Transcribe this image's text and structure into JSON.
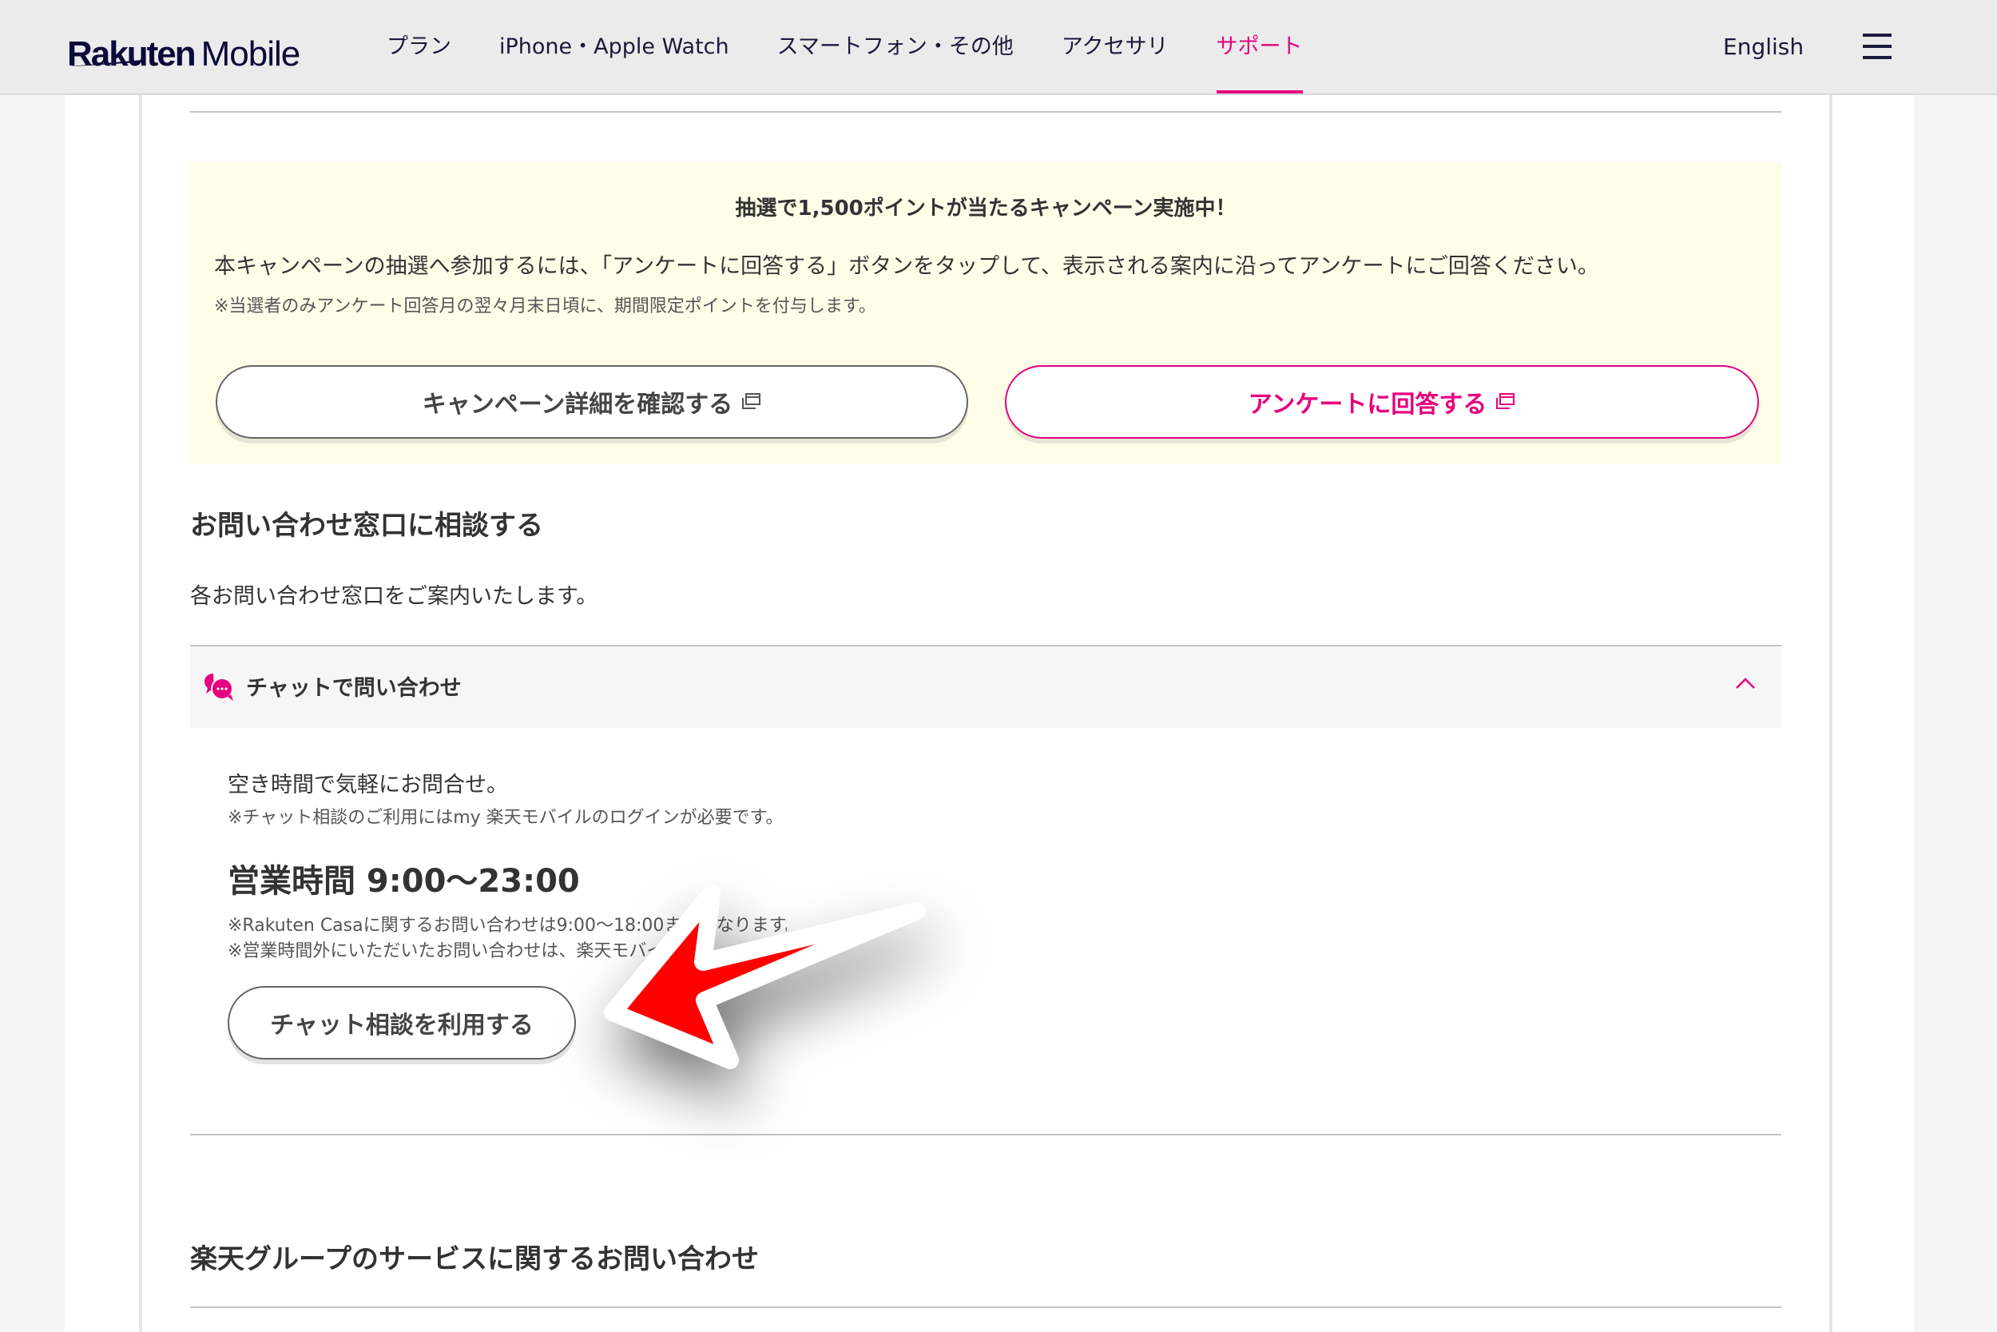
{
  "header": {
    "logo_primary": "Rakuten",
    "logo_secondary": "Mobile",
    "nav": [
      {
        "label": "プラン",
        "active": false
      },
      {
        "label": "iPhone・Apple Watch",
        "active": false
      },
      {
        "label": "スマートフォン・その他",
        "active": false
      },
      {
        "label": "アクセサリ",
        "active": false
      },
      {
        "label": "サポート",
        "active": true
      }
    ],
    "language_link": "English",
    "menu_icon": "hamburger-menu-icon"
  },
  "campaign": {
    "title": "抽選で1,500ポイントが当たるキャンペーン実施中！",
    "body": "本キャンペーンの抽選へ参加するには、「アンケートに回答する」ボタンをタップして、表示される案内に沿ってアンケートにご回答ください。",
    "note": "※当選者のみアンケート回答月の翌々月末日頃に、期間限定ポイントを付与します。",
    "details_button": "キャンペーン詳細を確認する",
    "survey_button": "アンケートに回答する",
    "external_icon": "external-window-icon"
  },
  "contact": {
    "title": "お問い合わせ窓口に相談する",
    "description": "各お問い合わせ窓口をご案内いたします。",
    "chat": {
      "header": "チャットで問い合わせ",
      "icon": "chat-bubbles-icon",
      "expanded": true,
      "lead": "空き時間で気軽にお問合せ。",
      "login_note": "※チャット相談のご利用にはmy 楽天モバイルのログインが必要です。",
      "hours": "営業時間 9:00〜23:00",
      "casa_note": "※Rakuten Casaに関するお問い合わせは9:00〜18:00までとなります。",
      "after_hours_note": "※営業時間外にいただいたお問い合わせは、楽天モバイルAI",
      "button": "チャット相談を利用する"
    }
  },
  "group_services": {
    "title": "楽天グループのサービスに関するお問い合わせ"
  },
  "annotation": {
    "type": "red-arrow",
    "points_to": "チャット相談を利用する",
    "color": "#ff0000",
    "outline": "#ffffff"
  },
  "colors": {
    "accent": "#e6007e",
    "brand_navy": "#0b0b3b",
    "campaign_bg": "#fefde8",
    "text": "#333333"
  }
}
